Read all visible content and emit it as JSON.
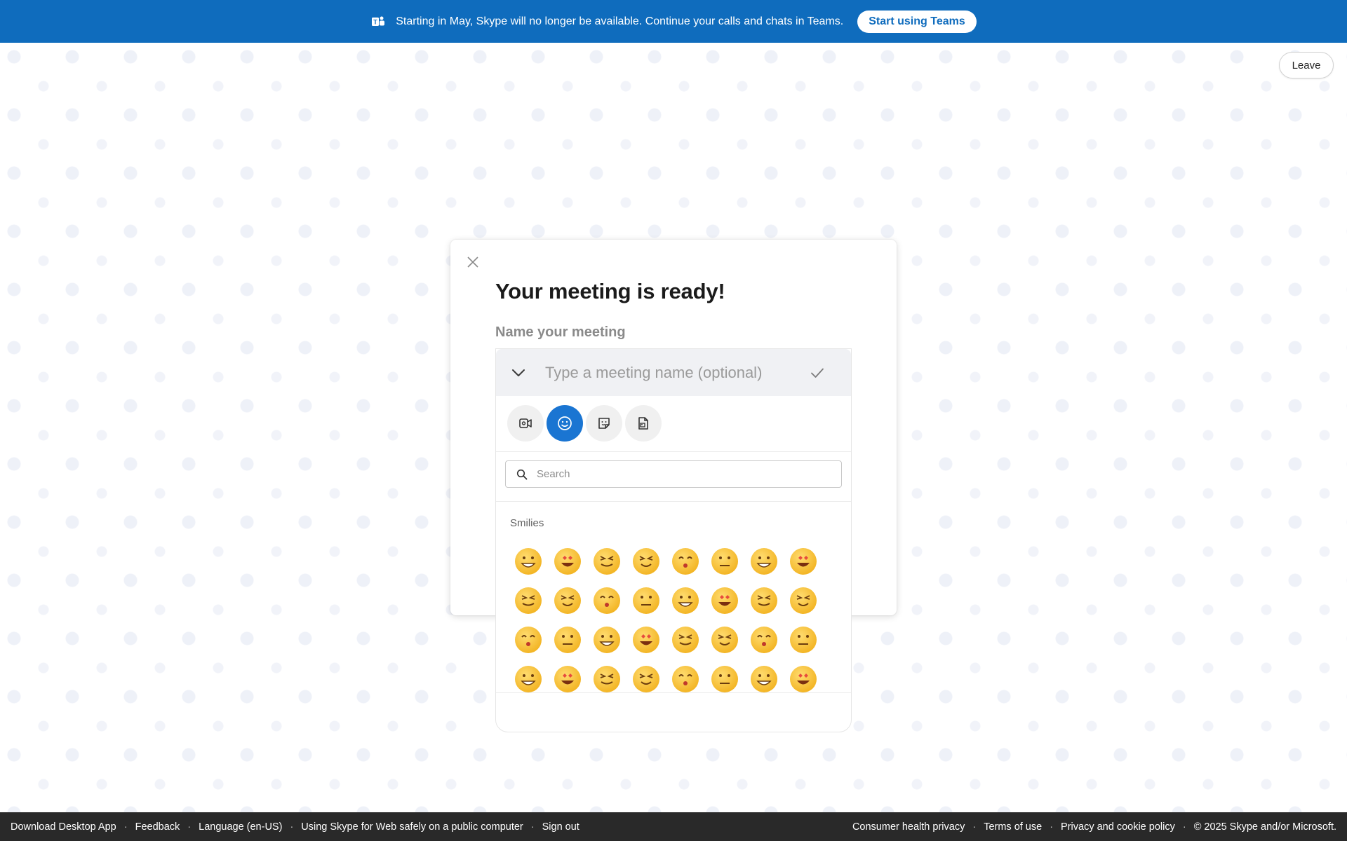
{
  "banner": {
    "text": "Starting in May, Skype will no longer be available. Continue your calls and chats in Teams.",
    "button_label": "Start using Teams",
    "bg_color": "#0f6cbd"
  },
  "header": {
    "leave_label": "Leave"
  },
  "dialog": {
    "title": "Your meeting is ready!",
    "name_label": "Name your meeting",
    "name_input": {
      "value": "",
      "placeholder": "Type a meeting name (optional)"
    }
  },
  "picker": {
    "tabs": [
      {
        "name": "video-message-icon",
        "active": false
      },
      {
        "name": "emoji-icon",
        "active": true
      },
      {
        "name": "sticker-icon",
        "active": false
      },
      {
        "name": "media-file-icon",
        "active": false
      }
    ],
    "search": {
      "value": "",
      "placeholder": "Search"
    },
    "section_label": "Smilies",
    "emoji_count": 32,
    "accent_color": "#1a75d2"
  },
  "footer": {
    "left_links": [
      "Download Desktop App",
      "Feedback",
      "Language (en-US)",
      "Using Skype for Web safely on a public computer",
      "Sign out"
    ],
    "right_links": [
      "Consumer health privacy",
      "Terms of use",
      "Privacy and cookie policy"
    ],
    "copyright": "© 2025 Skype and/or Microsoft."
  }
}
